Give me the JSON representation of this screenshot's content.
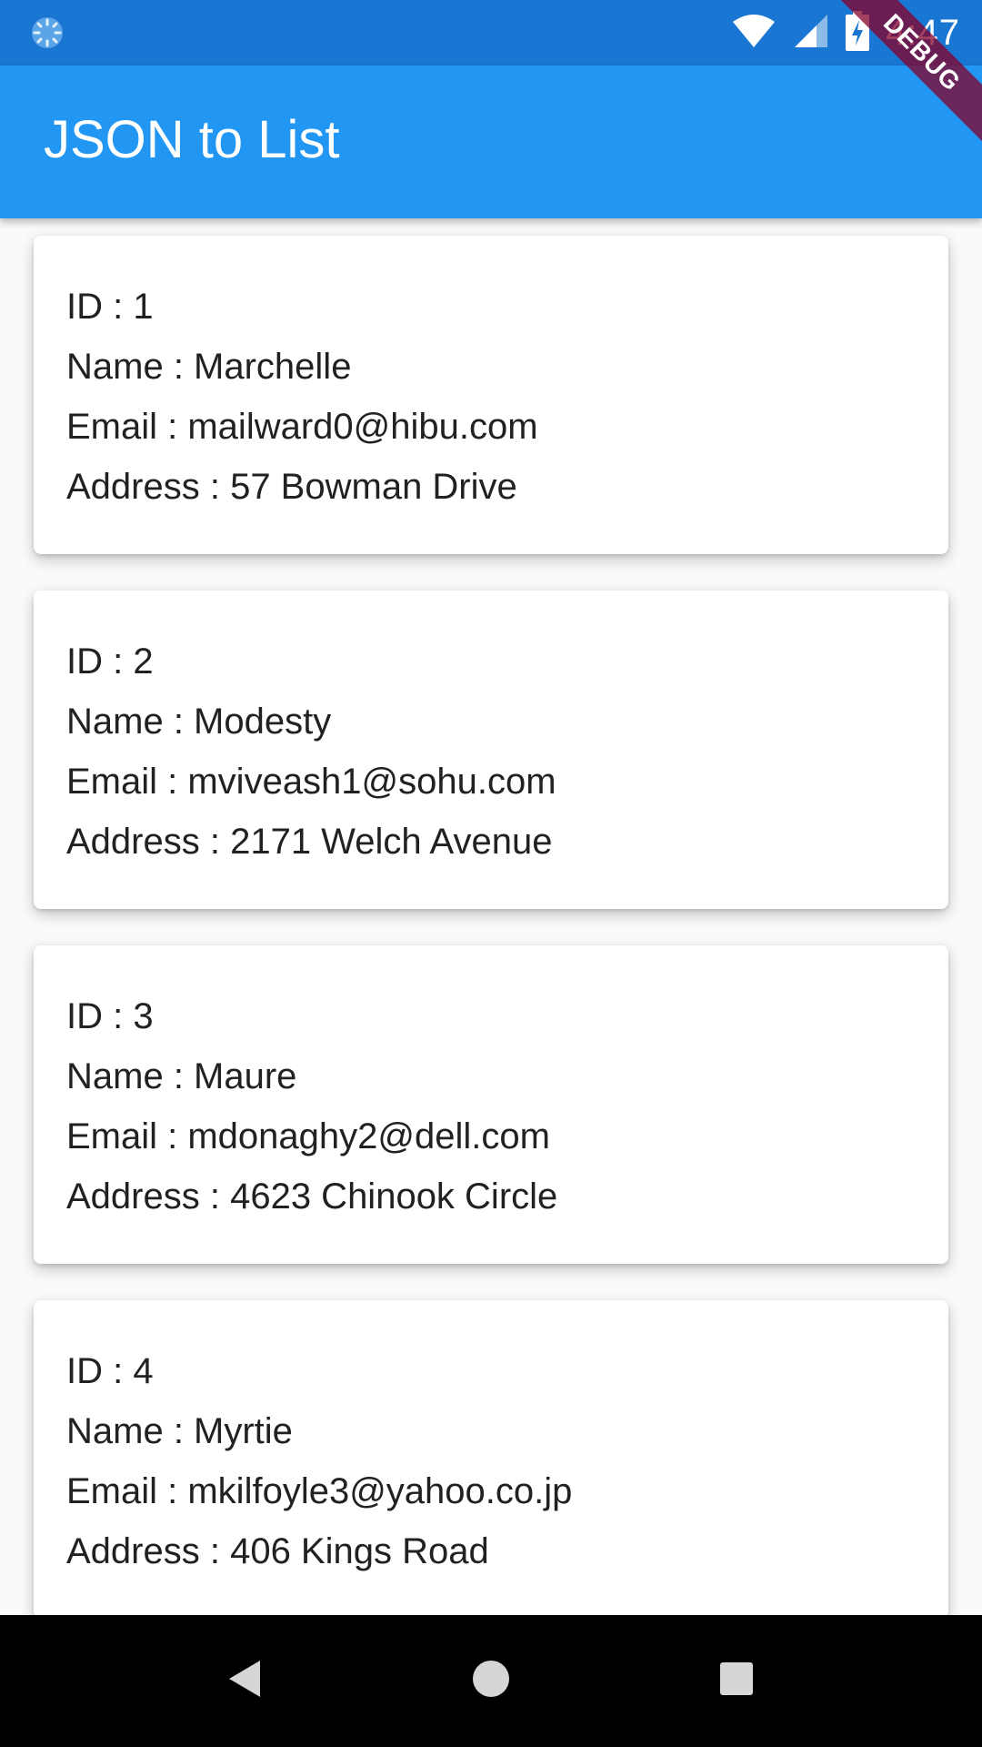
{
  "status_bar": {
    "time": "4:47",
    "icons": [
      "loading-icon",
      "wifi-icon",
      "cell-signal-icon",
      "battery-charging-icon"
    ]
  },
  "app_bar": {
    "title": "JSON to List"
  },
  "debug_banner": {
    "label": "DEBUG"
  },
  "items": [
    {
      "id": "ID : 1",
      "name": "Name : Marchelle",
      "email": "Email : mailward0@hibu.com",
      "address": "Address : 57 Bowman Drive"
    },
    {
      "id": "ID : 2",
      "name": "Name : Modesty",
      "email": "Email : mviveash1@sohu.com",
      "address": "Address : 2171 Welch Avenue"
    },
    {
      "id": "ID : 3",
      "name": "Name : Maure",
      "email": "Email : mdonaghy2@dell.com",
      "address": "Address : 4623 Chinook Circle"
    },
    {
      "id": "ID : 4",
      "name": "Name : Myrtie",
      "email": "Email : mkilfoyle3@yahoo.co.jp",
      "address": "Address : 406 Kings Road"
    }
  ],
  "nav_bar": {
    "buttons": [
      "back-icon",
      "home-icon",
      "recents-icon"
    ]
  },
  "colors": {
    "status_bar": "#1976d2",
    "app_bar": "#2196f3",
    "background": "#fafafa",
    "card": "#ffffff",
    "text": "#212121",
    "debug_banner": "#840028",
    "nav_bar": "#000000"
  }
}
